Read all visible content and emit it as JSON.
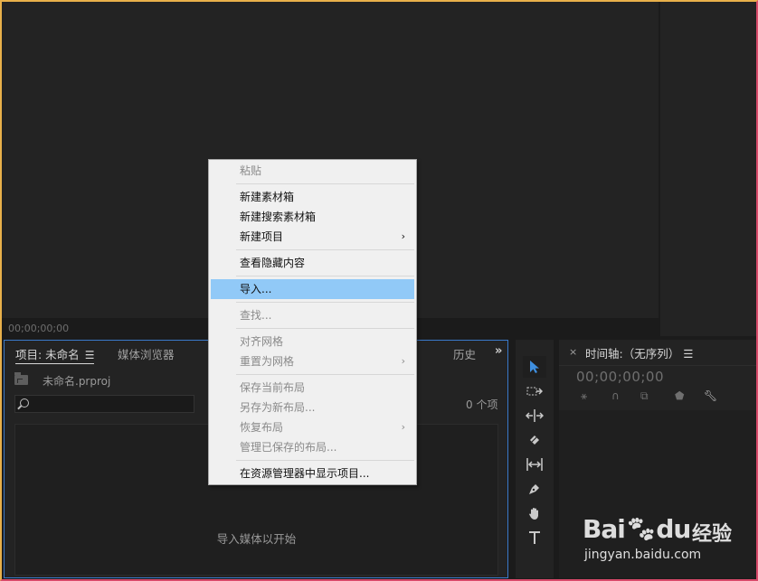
{
  "monitor": {
    "timecode": "00;00;00;00"
  },
  "project_panel": {
    "tab_project": "项目: 未命名",
    "tab_media_browser": "媒体浏览器",
    "tab_history": "历史",
    "project_file": "未命名.prproj",
    "item_count": "0 个项",
    "empty_hint": "导入媒体以开始",
    "search_placeholder": ""
  },
  "timeline_panel": {
    "title": "时间轴:（无序列）",
    "timecode": "00;00;00;00"
  },
  "context_menu": {
    "paste": "粘贴",
    "new_bin": "新建素材箱",
    "new_search_bin": "新建搜索素材箱",
    "new_item": "新建项目",
    "view_hidden": "查看隐藏内容",
    "import": "导入...",
    "find": "查找...",
    "align_to_grid": "对齐网格",
    "reset_to_grid": "重置为网格",
    "save_current_layout": "保存当前布局",
    "save_as_new_layout": "另存为新布局...",
    "restore_layout": "恢复布局",
    "manage_saved_layouts": "管理已保存的布局...",
    "reveal_in_explorer": "在资源管理器中显示项目..."
  },
  "watermark": {
    "logo": "Bai",
    "logo_tail": "du",
    "sub": "经验",
    "url": "jingyan.baidu.com"
  },
  "icons": [
    "selection-tool-icon",
    "track-select-tool-icon",
    "ripple-edit-tool-icon",
    "razor-tool-icon",
    "slip-tool-icon",
    "pen-tool-icon",
    "hand-tool-icon",
    "type-tool-icon"
  ],
  "colors": {
    "accent": "#3a79c9",
    "menu_highlight": "#91c9f7",
    "panel_bg": "#232323"
  }
}
